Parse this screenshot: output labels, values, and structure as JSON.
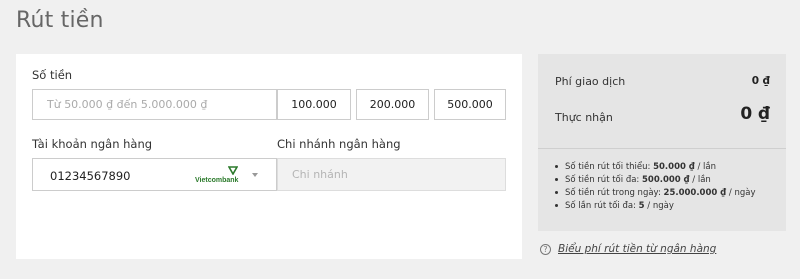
{
  "page": {
    "title": "Rút tiền"
  },
  "form": {
    "amount_label": "Số tiền",
    "amount_placeholder": "Từ 50.000 ₫ đến 5.000.000 ₫",
    "quick_amounts": [
      "100.000",
      "200.000",
      "500.000"
    ],
    "bank_account_label": "Tài khoản ngân hàng",
    "bank_account_value": "01234567890",
    "bank_name": "Vietcombank",
    "branch_label": "Chi nhánh ngân hàng",
    "branch_placeholder": "Chi nhánh"
  },
  "summary": {
    "fee_label": "Phí giao dịch",
    "fee_value": "0 ₫",
    "net_label": "Thực nhận",
    "net_value": "0 ₫",
    "rules": [
      {
        "prefix": "Số tiền rút tối thiểu: ",
        "value": "50.000 ₫",
        "suffix": " / lần"
      },
      {
        "prefix": "Số tiền rút tối đa: ",
        "value": "500.000 ₫",
        "suffix": " / lần"
      },
      {
        "prefix": "Số tiền rút trong ngày: ",
        "value": "25.000.000 ₫",
        "suffix": " / ngày"
      },
      {
        "prefix": "Số lần rút tối đa: ",
        "value": "5",
        "suffix": " / ngày"
      }
    ]
  },
  "fee_link": {
    "label": "Biểu phí rút tiền từ ngân hàng"
  },
  "colors": {
    "background": "#f0f0f0",
    "summary_background": "#e5e5e5",
    "bank_green": "#2b7a2b"
  }
}
